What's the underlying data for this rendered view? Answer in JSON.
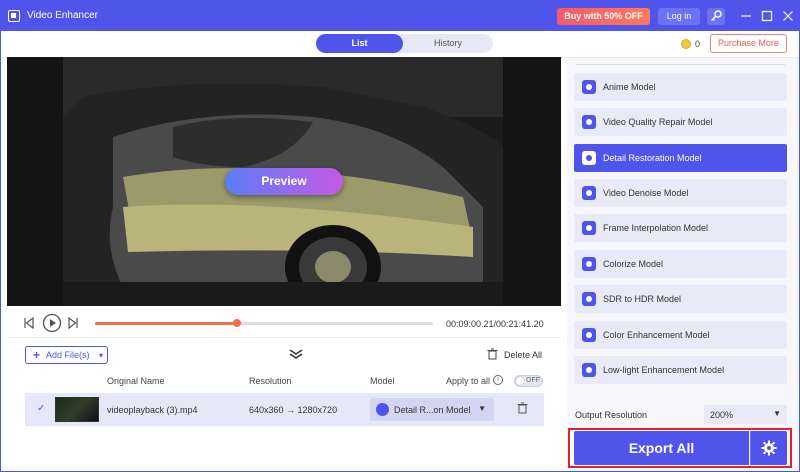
{
  "app": {
    "title": "Video Enhancer",
    "buy_label": "Buy with 50% OFF",
    "login_label": "Log in",
    "brand_color": "#4f55ea"
  },
  "tabs": [
    {
      "label": "List",
      "active": true
    },
    {
      "label": "History",
      "active": false
    }
  ],
  "credits": {
    "count": "0",
    "purchase_label": "Purchase More"
  },
  "preview": {
    "button_label": "Preview"
  },
  "player": {
    "time": "00:09:00.21/00:21:41.20",
    "progress": 0.42
  },
  "toolbar": {
    "add_label": "Add File(s)",
    "delete_all_label": "Delete All"
  },
  "columns": {
    "name": "Original Name",
    "resolution": "Resolution",
    "model": "Model",
    "apply_all": "Apply to all",
    "toggle_state": "OFF"
  },
  "files": [
    {
      "name": "videoplayback (3).mp4",
      "resolution": "640x360 → 1280x720",
      "model": "Detail R...on Model"
    }
  ],
  "models": [
    {
      "label": "Anime Model",
      "icon": "anime-icon",
      "selected": false
    },
    {
      "label": "Video Quality Repair Model",
      "icon": "repair-icon",
      "selected": false
    },
    {
      "label": "Detail Restoration Model",
      "icon": "detail-icon",
      "selected": true
    },
    {
      "label": "Video Denoise Model",
      "icon": "denoise-icon",
      "selected": false
    },
    {
      "label": "Frame Interpolation Model",
      "icon": "frame-icon",
      "selected": false
    },
    {
      "label": "Colorize Model",
      "icon": "colorize-icon",
      "selected": false
    },
    {
      "label": "SDR to HDR Model",
      "icon": "hdr-icon",
      "selected": false
    },
    {
      "label": "Color Enhancement Model",
      "icon": "palette-icon",
      "selected": false
    },
    {
      "label": "Low-light Enhancement Model",
      "icon": "moon-icon",
      "selected": false
    }
  ],
  "output": {
    "resolution_label": "Output Resolution",
    "resolution_value": "200%"
  },
  "export": {
    "label": "Export All"
  }
}
